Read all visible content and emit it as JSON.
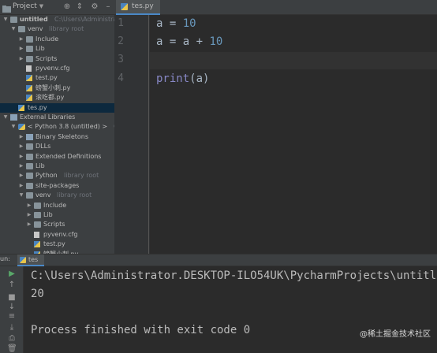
{
  "project": {
    "title": "Project",
    "tree": [
      {
        "label": "untitled",
        "hint": "C:\\Users\\Administrator.DE",
        "arrow": "down",
        "icon": "folder",
        "depth": 0,
        "bold": true
      },
      {
        "label": "venv",
        "hint": "library root",
        "arrow": "down",
        "icon": "folder",
        "depth": 1
      },
      {
        "label": "Include",
        "hint": "",
        "arrow": "right",
        "icon": "folder",
        "depth": 2
      },
      {
        "label": "Lib",
        "hint": "",
        "arrow": "right",
        "icon": "folder",
        "depth": 2
      },
      {
        "label": "Scripts",
        "hint": "",
        "arrow": "right",
        "icon": "folder",
        "depth": 2
      },
      {
        "label": "pyvenv.cfg",
        "hint": "",
        "arrow": "",
        "icon": "file",
        "depth": 2
      },
      {
        "label": "test.py",
        "hint": "",
        "arrow": "",
        "icon": "py",
        "depth": 2
      },
      {
        "label": "螃蟹小刺.py",
        "hint": "",
        "arrow": "",
        "icon": "py",
        "depth": 2
      },
      {
        "label": "滚吃都.py",
        "hint": "",
        "arrow": "",
        "icon": "py",
        "depth": 2
      },
      {
        "label": "tes.py",
        "hint": "",
        "arrow": "",
        "icon": "py",
        "depth": 1,
        "selected": true
      },
      {
        "label": "External Libraries",
        "hint": "",
        "arrow": "down",
        "icon": "lib",
        "depth": 0
      },
      {
        "label": "< Python 3.8 (untitled) >",
        "hint": "C:\\Users",
        "arrow": "down",
        "icon": "python",
        "depth": 1
      },
      {
        "label": "Binary Skeletons",
        "hint": "",
        "arrow": "right",
        "icon": "lib",
        "depth": 2
      },
      {
        "label": "DLLs",
        "hint": "",
        "arrow": "right",
        "icon": "folder",
        "depth": 2
      },
      {
        "label": "Extended Definitions",
        "hint": "",
        "arrow": "right",
        "icon": "folder",
        "depth": 2
      },
      {
        "label": "Lib",
        "hint": "",
        "arrow": "right",
        "icon": "folder",
        "depth": 2
      },
      {
        "label": "Python",
        "hint": "library root",
        "arrow": "right",
        "icon": "folder",
        "depth": 2
      },
      {
        "label": "site-packages",
        "hint": "",
        "arrow": "right",
        "icon": "folder",
        "depth": 2
      },
      {
        "label": "venv",
        "hint": "library root",
        "arrow": "down",
        "icon": "folder",
        "depth": 2
      },
      {
        "label": "Include",
        "hint": "",
        "arrow": "right",
        "icon": "folder",
        "depth": 3
      },
      {
        "label": "Lib",
        "hint": "",
        "arrow": "right",
        "icon": "folder",
        "depth": 3
      },
      {
        "label": "Scripts",
        "hint": "",
        "arrow": "right",
        "icon": "folder",
        "depth": 3
      },
      {
        "label": "pyvenv.cfg",
        "hint": "",
        "arrow": "",
        "icon": "file",
        "depth": 3
      },
      {
        "label": "test.py",
        "hint": "",
        "arrow": "",
        "icon": "py",
        "depth": 3
      },
      {
        "label": "螃蟹小刺.py",
        "hint": "",
        "arrow": "",
        "icon": "py",
        "depth": 3
      }
    ]
  },
  "editor": {
    "tab_label": "tes.py",
    "line_numbers": [
      "1",
      "2",
      "3",
      "4"
    ],
    "lines": [
      {
        "parts": [
          {
            "t": "a = ",
            "c": ""
          },
          {
            "t": "10",
            "c": "num"
          }
        ]
      },
      {
        "parts": [
          {
            "t": "a = a + ",
            "c": ""
          },
          {
            "t": "10",
            "c": "num"
          }
        ]
      },
      {
        "parts": []
      },
      {
        "parts": [
          {
            "t": "print",
            "c": "builtin"
          },
          {
            "t": "(a)",
            "c": ""
          }
        ]
      }
    ]
  },
  "run": {
    "label": "un:",
    "tab_label": "tes",
    "console": [
      "C:\\Users\\Administrator.DESKTOP-ILO54UK\\PycharmProjects\\untitled",
      "20",
      "",
      "Process finished with exit code 0"
    ]
  },
  "watermark": "@稀土掘金技术社区"
}
